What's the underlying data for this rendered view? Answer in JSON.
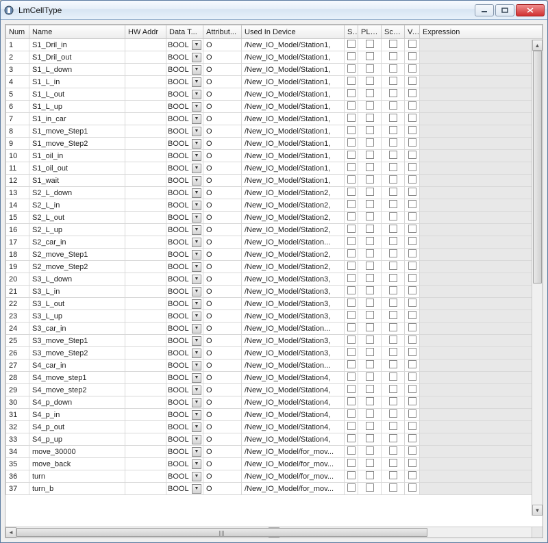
{
  "window": {
    "title": "LmCellType"
  },
  "columns": {
    "num": "Num",
    "name": "Name",
    "hw": "HW Addr",
    "dt": "Data T...",
    "attr": "Attribut...",
    "used": "Used In Device",
    "s": "S...",
    "plc": "PLC ...",
    "scri": "Scri...",
    "v": "V...",
    "expr": "Expression"
  },
  "rows": [
    {
      "num": "1",
      "name": "S1_Dril_in",
      "dt": "BOOL",
      "attr": "O",
      "used": "/New_IO_Model/Station1,"
    },
    {
      "num": "2",
      "name": "S1_Dril_out",
      "dt": "BOOL",
      "attr": "O",
      "used": "/New_IO_Model/Station1,"
    },
    {
      "num": "3",
      "name": "S1_L_down",
      "dt": "BOOL",
      "attr": "O",
      "used": "/New_IO_Model/Station1,"
    },
    {
      "num": "4",
      "name": "S1_L_in",
      "dt": "BOOL",
      "attr": "O",
      "used": "/New_IO_Model/Station1,"
    },
    {
      "num": "5",
      "name": "S1_L_out",
      "dt": "BOOL",
      "attr": "O",
      "used": "/New_IO_Model/Station1,"
    },
    {
      "num": "6",
      "name": "S1_L_up",
      "dt": "BOOL",
      "attr": "O",
      "used": "/New_IO_Model/Station1,"
    },
    {
      "num": "7",
      "name": "S1_in_car",
      "dt": "BOOL",
      "attr": "O",
      "used": "/New_IO_Model/Station1,"
    },
    {
      "num": "8",
      "name": "S1_move_Step1",
      "dt": "BOOL",
      "attr": "O",
      "used": "/New_IO_Model/Station1,"
    },
    {
      "num": "9",
      "name": "S1_move_Step2",
      "dt": "BOOL",
      "attr": "O",
      "used": "/New_IO_Model/Station1,"
    },
    {
      "num": "10",
      "name": "S1_oil_in",
      "dt": "BOOL",
      "attr": "O",
      "used": "/New_IO_Model/Station1,"
    },
    {
      "num": "11",
      "name": "S1_oil_out",
      "dt": "BOOL",
      "attr": "O",
      "used": "/New_IO_Model/Station1,"
    },
    {
      "num": "12",
      "name": "S1_wait",
      "dt": "BOOL",
      "attr": "O",
      "used": "/New_IO_Model/Station1,"
    },
    {
      "num": "13",
      "name": "S2_L_down",
      "dt": "BOOL",
      "attr": "O",
      "used": "/New_IO_Model/Station2,"
    },
    {
      "num": "14",
      "name": "S2_L_in",
      "dt": "BOOL",
      "attr": "O",
      "used": "/New_IO_Model/Station2,"
    },
    {
      "num": "15",
      "name": "S2_L_out",
      "dt": "BOOL",
      "attr": "O",
      "used": "/New_IO_Model/Station2,"
    },
    {
      "num": "16",
      "name": "S2_L_up",
      "dt": "BOOL",
      "attr": "O",
      "used": "/New_IO_Model/Station2,"
    },
    {
      "num": "17",
      "name": "S2_car_in",
      "dt": "BOOL",
      "attr": "O",
      "used": "/New_IO_Model/Station..."
    },
    {
      "num": "18",
      "name": "S2_move_Step1",
      "dt": "BOOL",
      "attr": "O",
      "used": "/New_IO_Model/Station2,"
    },
    {
      "num": "19",
      "name": "S2_move_Step2",
      "dt": "BOOL",
      "attr": "O",
      "used": "/New_IO_Model/Station2,"
    },
    {
      "num": "20",
      "name": "S3_L_down",
      "dt": "BOOL",
      "attr": "O",
      "used": "/New_IO_Model/Station3,"
    },
    {
      "num": "21",
      "name": "S3_L_in",
      "dt": "BOOL",
      "attr": "O",
      "used": "/New_IO_Model/Station3,"
    },
    {
      "num": "22",
      "name": "S3_L_out",
      "dt": "BOOL",
      "attr": "O",
      "used": "/New_IO_Model/Station3,"
    },
    {
      "num": "23",
      "name": "S3_L_up",
      "dt": "BOOL",
      "attr": "O",
      "used": "/New_IO_Model/Station3,"
    },
    {
      "num": "24",
      "name": "S3_car_in",
      "dt": "BOOL",
      "attr": "O",
      "used": "/New_IO_Model/Station..."
    },
    {
      "num": "25",
      "name": "S3_move_Step1",
      "dt": "BOOL",
      "attr": "O",
      "used": "/New_IO_Model/Station3,"
    },
    {
      "num": "26",
      "name": "S3_move_Step2",
      "dt": "BOOL",
      "attr": "O",
      "used": "/New_IO_Model/Station3,"
    },
    {
      "num": "27",
      "name": "S4_car_in",
      "dt": "BOOL",
      "attr": "O",
      "used": "/New_IO_Model/Station..."
    },
    {
      "num": "28",
      "name": "S4_move_step1",
      "dt": "BOOL",
      "attr": "O",
      "used": "/New_IO_Model/Station4,"
    },
    {
      "num": "29",
      "name": "S4_move_step2",
      "dt": "BOOL",
      "attr": "O",
      "used": "/New_IO_Model/Station4,"
    },
    {
      "num": "30",
      "name": "S4_p_down",
      "dt": "BOOL",
      "attr": "O",
      "used": "/New_IO_Model/Station4,"
    },
    {
      "num": "31",
      "name": "S4_p_in",
      "dt": "BOOL",
      "attr": "O",
      "used": "/New_IO_Model/Station4,"
    },
    {
      "num": "32",
      "name": "S4_p_out",
      "dt": "BOOL",
      "attr": "O",
      "used": "/New_IO_Model/Station4,"
    },
    {
      "num": "33",
      "name": "S4_p_up",
      "dt": "BOOL",
      "attr": "O",
      "used": "/New_IO_Model/Station4,"
    },
    {
      "num": "34",
      "name": "move_30000",
      "dt": "BOOL",
      "attr": "O",
      "used": "/New_IO_Model/for_mov..."
    },
    {
      "num": "35",
      "name": "move_back",
      "dt": "BOOL",
      "attr": "O",
      "used": "/New_IO_Model/for_mov..."
    },
    {
      "num": "36",
      "name": "turn",
      "dt": "BOOL",
      "attr": "O",
      "used": "/New_IO_Model/for_mov..."
    },
    {
      "num": "37",
      "name": "turn_b",
      "dt": "BOOL",
      "attr": "O",
      "used": "/New_IO_Model/for_mov..."
    }
  ]
}
